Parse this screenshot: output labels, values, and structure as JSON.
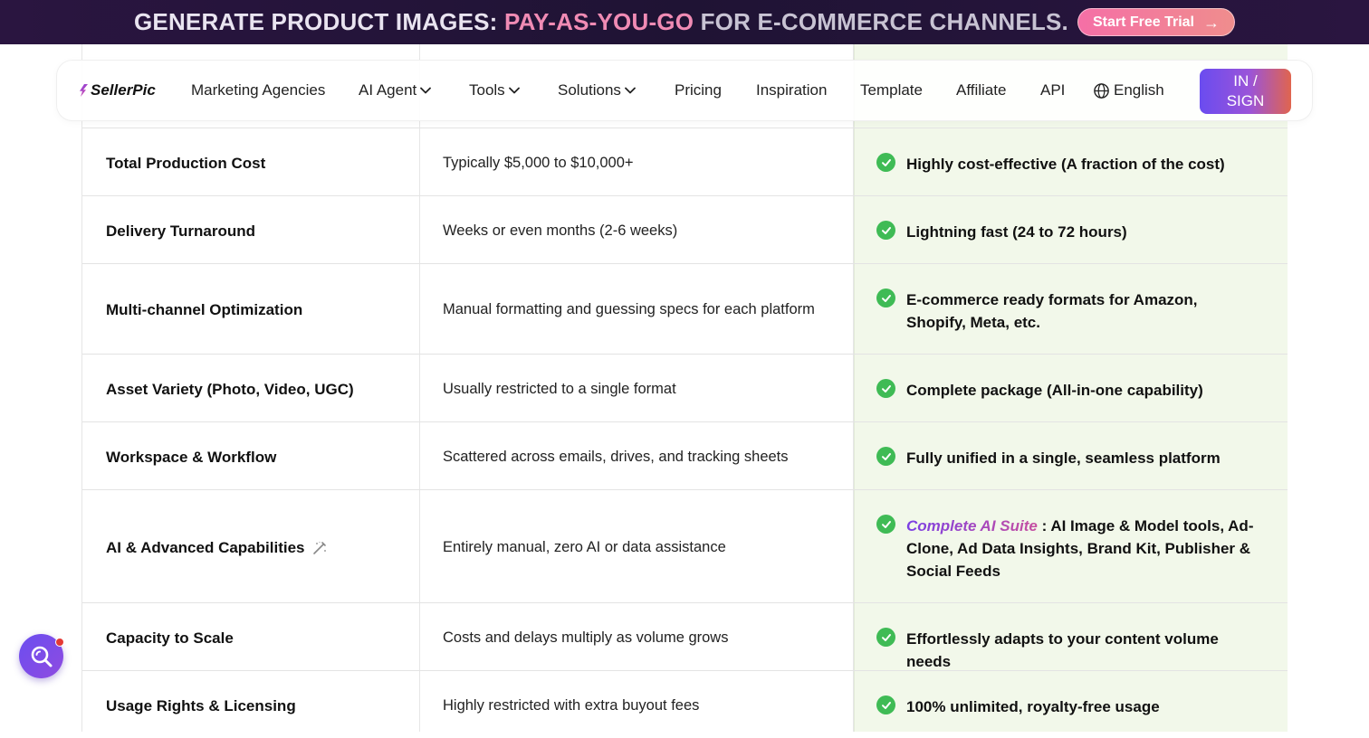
{
  "promo": {
    "part1": "GENERATE PRODUCT IMAGES: ",
    "highlight": "PAY-AS-YOU-GO",
    "part2": " FOR E-COMMERCE CHANNELS.",
    "cta": "Start Free Trial"
  },
  "nav": {
    "logo": "SellerPic",
    "items": [
      "Marketing Agencies",
      "AI Agent",
      "Tools",
      "Solutions",
      "Pricing",
      "Inspiration",
      "Template",
      "Affiliate",
      "API"
    ],
    "language": "English",
    "signin_line1": "IN /",
    "signin_line2": "SIGN"
  },
  "rows": [
    {
      "feature": "Total Production Cost",
      "traditional": "Typically $5,000 to $10,000+",
      "sellerpic": "Highly cost-effective (A fraction of the cost)"
    },
    {
      "feature": "Delivery Turnaround",
      "traditional": "Weeks or even months (2-6 weeks)",
      "sellerpic": "Lightning fast (24 to 72 hours)"
    },
    {
      "feature": "Multi-channel Optimization",
      "traditional": "Manual formatting and guessing specs for each platform",
      "sellerpic": "E-commerce ready formats for Amazon, Shopify, Meta, etc."
    },
    {
      "feature": "Asset Variety (Photo, Video, UGC)",
      "traditional": "Usually restricted to a single format",
      "sellerpic": "Complete package (All-in-one capability)"
    },
    {
      "feature": "Workspace & Workflow",
      "traditional": "Scattered across emails, drives, and tracking sheets",
      "sellerpic": "Fully unified in a single, seamless platform"
    },
    {
      "feature": "AI & Advanced Capabilities",
      "traditional": "Entirely manual, zero AI or data assistance",
      "sellerpic_highlight": "Complete AI Suite",
      "sellerpic": " : AI Image & Model tools, Ad-Clone, Ad Data Insights, Brand Kit, Publisher & Social Feeds"
    },
    {
      "feature": "Capacity to Scale",
      "traditional": "Costs and delays multiply as volume grows",
      "sellerpic": "Effortlessly adapts to your content volume needs"
    },
    {
      "feature": "Usage Rights & Licensing",
      "traditional": "Highly restricted with extra buyout fees",
      "sellerpic": "100% unlimited, royalty-free usage"
    }
  ],
  "colors": {
    "accent": "#6b4ef0",
    "check": "#3fbb55",
    "highlight_col": "#f2f8ea"
  }
}
